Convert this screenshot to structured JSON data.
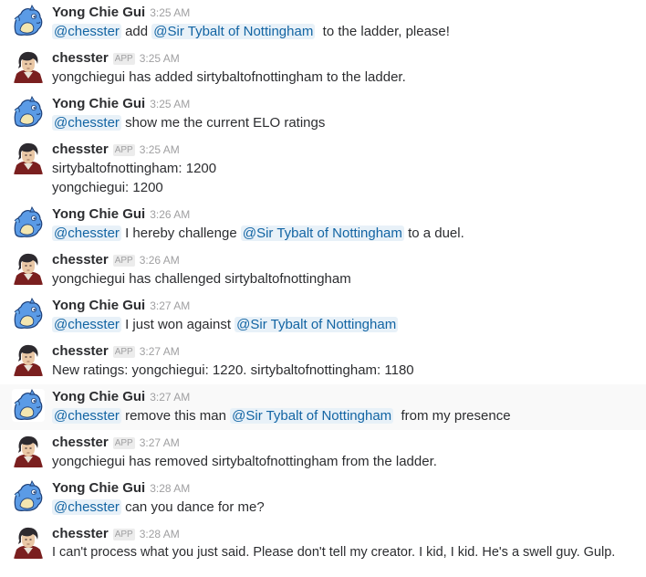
{
  "names": {
    "user": "Yong Chie Gui",
    "bot": "chesster",
    "app_badge": "APP",
    "mention_bot": "@chesster",
    "mention_sir": "@Sir Tybalt of Nottingham"
  },
  "colors": {
    "mention_text": "#1264a3",
    "mention_bg": "#e8f1f8",
    "timestamp": "#a0a0a2",
    "hover_row": "#f9f9f9"
  },
  "icons": {
    "user_avatar": "blue-dragon-avatar-icon",
    "bot_avatar": "chesster-bot-avatar-icon"
  },
  "messages": [
    {
      "time": "3:25 AM",
      "t1": "add",
      "t2": "to the ladder, please!"
    },
    {
      "time": "3:25 AM",
      "text": "yongchiegui has added sirtybaltofnottingham to the ladder."
    },
    {
      "time": "3:25 AM",
      "t1": "show me the current ELO ratings"
    },
    {
      "time": "3:25 AM",
      "lines": [
        "sirtybaltofnottingham: 1200",
        "yongchiegui: 1200"
      ]
    },
    {
      "time": "3:26 AM",
      "t1": "I hereby challenge",
      "t2": "to a duel."
    },
    {
      "time": "3:26 AM",
      "text": "yongchiegui has challenged sirtybaltofnottingham"
    },
    {
      "time": "3:27 AM",
      "t1": "I just won against"
    },
    {
      "time": "3:27 AM",
      "text": "New ratings: yongchiegui: 1220. sirtybaltofnottingham: 1180"
    },
    {
      "time": "3:27 AM",
      "t1": "remove this man",
      "t2": "from my presence"
    },
    {
      "time": "3:27 AM",
      "text": "yongchiegui has removed sirtybaltofnottingham from the ladder."
    },
    {
      "time": "3:28 AM",
      "t1": "can you dance for me?"
    },
    {
      "time": "3:28 AM",
      "text": "I can't process what you just said. Please don't tell my creator. I kid, I kid. He's a swell guy. Gulp."
    }
  ]
}
